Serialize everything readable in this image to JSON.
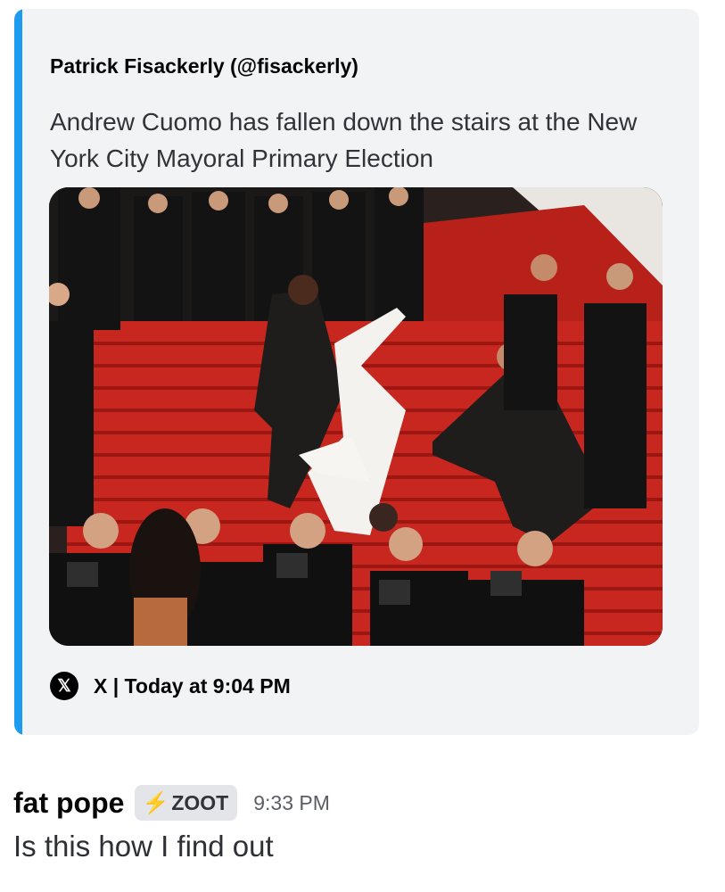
{
  "embed": {
    "author": "Patrick Fisackerly (@fisackerly)",
    "description": "Andrew Cuomo has fallen down the stairs at the New York City Mayoral Primary Election",
    "footer_text": "X | Today at 9:04 PM",
    "footer_icon": "x-logo-icon",
    "accent_color": "#1d9bf0",
    "image": "photo of a man in a white suit tumbling down red-carpeted stairs while a man in a dark suit reaches for him, photographers in the foreground"
  },
  "message": {
    "username": "fat pope",
    "tag_icon": "lightning-bolt-icon",
    "tag": "ZOOT",
    "timestamp": "9:33 PM",
    "text": "Is this how I find out"
  }
}
